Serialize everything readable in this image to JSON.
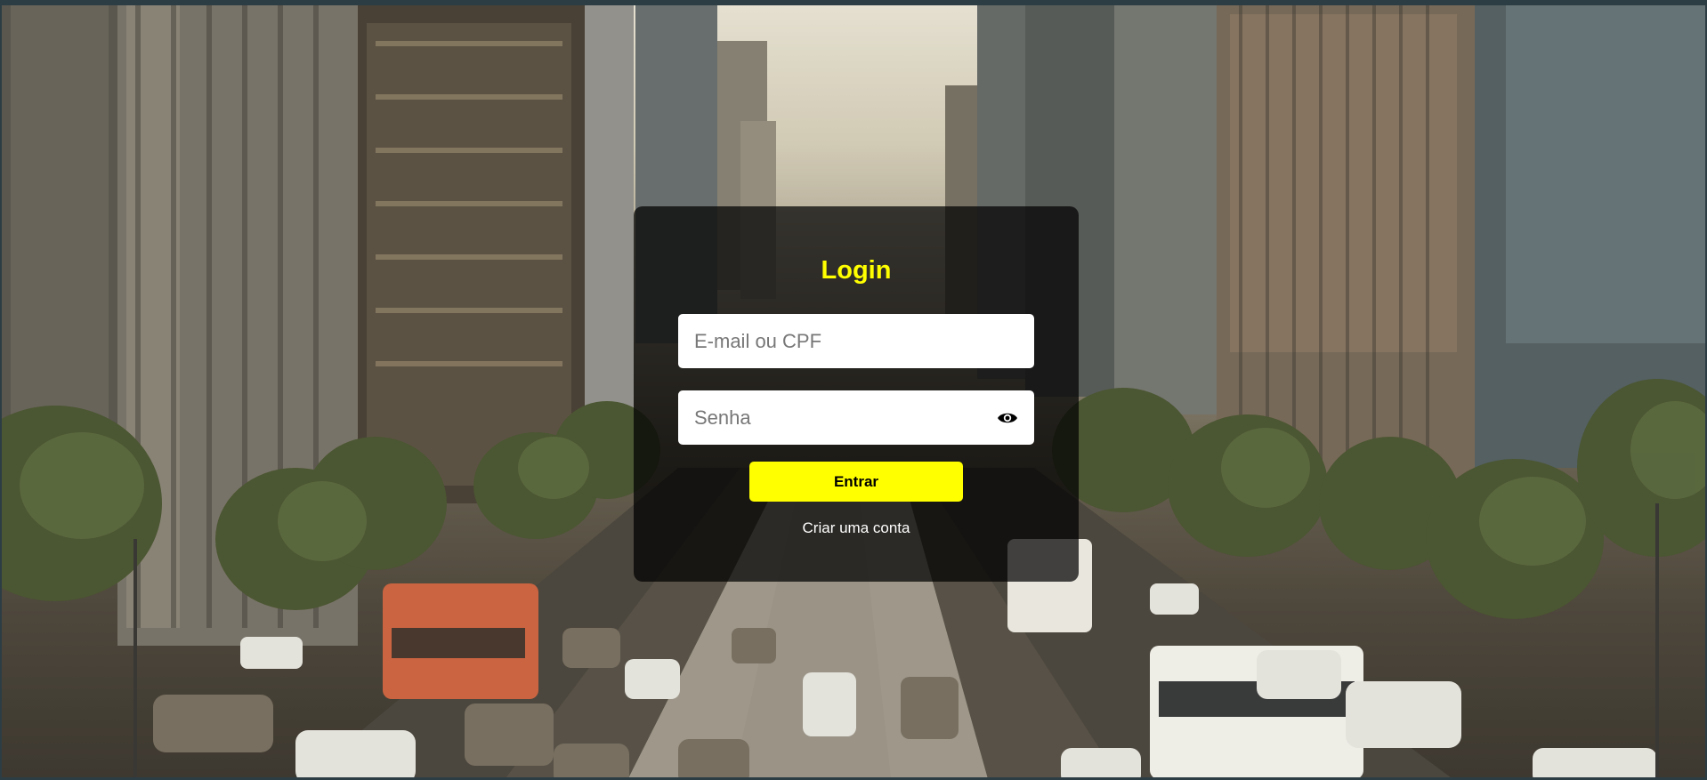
{
  "login": {
    "title": "Login",
    "email": {
      "placeholder": "E-mail ou CPF",
      "value": ""
    },
    "password": {
      "placeholder": "Senha",
      "value": ""
    },
    "toggle_icon": "eye-icon",
    "submit_label": "Entrar",
    "signup_label": "Criar uma conta"
  },
  "colors": {
    "accent": "#ffff00",
    "card_background": "rgba(0,0,0,0.72)",
    "link": "#ffffff"
  }
}
